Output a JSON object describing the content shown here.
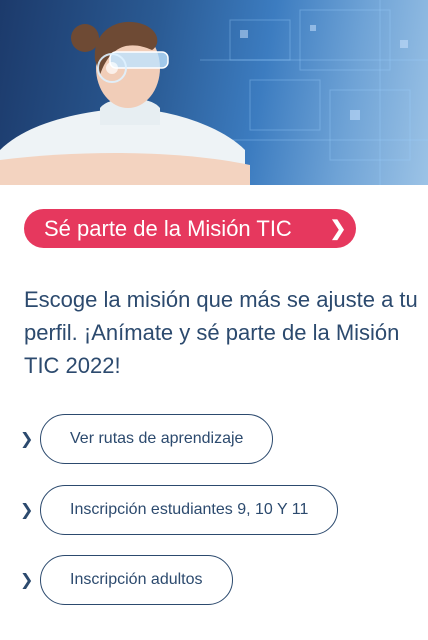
{
  "hero": {
    "image": "woman-with-tech-glasses-photo"
  },
  "cta": {
    "label": "Sé parte de la Misión TIC",
    "icon": "chevron-right-icon",
    "color": "#e6385e"
  },
  "intro": {
    "text": "Escoge la misión que más se ajuste a tu perfil. ¡Anímate y sé parte de la Misión TIC 2022!"
  },
  "links": [
    {
      "label": "Ver rutas de aprendizaje",
      "icon": "chevron-right-icon"
    },
    {
      "label": "Inscripción estudiantes 9, 10 Y 11",
      "icon": "chevron-right-icon"
    },
    {
      "label": "Inscripción adultos",
      "icon": "chevron-right-icon"
    }
  ],
  "colors": {
    "text": "#2c4a6e",
    "accent": "#e6385e"
  }
}
